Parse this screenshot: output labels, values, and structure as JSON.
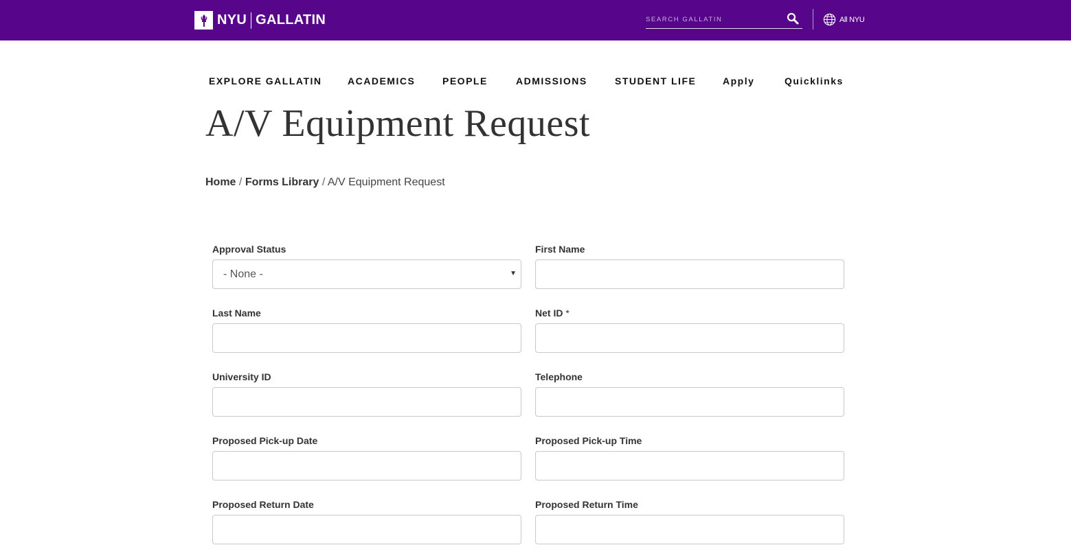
{
  "header": {
    "logo_nyu": "NYU",
    "logo_gallatin": "GALLATIN",
    "search_placeholder": "SEARCH GALLATIN",
    "all_nyu": "All NYU",
    "brand_color": "#57068c"
  },
  "nav": {
    "items": [
      {
        "label": "EXPLORE GALLATIN"
      },
      {
        "label": "ACADEMICS"
      },
      {
        "label": "PEOPLE"
      },
      {
        "label": "ADMISSIONS"
      },
      {
        "label": "STUDENT LIFE"
      },
      {
        "label": "Apply"
      },
      {
        "label": "Quicklinks"
      }
    ]
  },
  "page": {
    "title": "A/V Equipment Request"
  },
  "breadcrumb": {
    "home": "Home",
    "sep": "/",
    "forms_library": "Forms Library",
    "current": "A/V Equipment Request"
  },
  "form": {
    "approval_status": {
      "label": "Approval Status",
      "value": "- None -"
    },
    "first_name": {
      "label": "First Name",
      "value": ""
    },
    "last_name": {
      "label": "Last Name",
      "value": ""
    },
    "net_id": {
      "label": "Net ID",
      "required_mark": "*",
      "value": ""
    },
    "university_id": {
      "label": "University ID",
      "value": ""
    },
    "telephone": {
      "label": "Telephone",
      "value": ""
    },
    "pickup_date": {
      "label": "Proposed Pick-up Date",
      "value": ""
    },
    "pickup_time": {
      "label": "Proposed Pick-up Time",
      "value": ""
    },
    "return_date": {
      "label": "Proposed Return Date",
      "value": ""
    },
    "return_time": {
      "label": "Proposed Return Time",
      "value": ""
    }
  },
  "icons": {
    "logo": "nyu-torch-icon",
    "search": "search-icon",
    "globe": "globe-icon",
    "select_caret": "caret-down-icon"
  }
}
